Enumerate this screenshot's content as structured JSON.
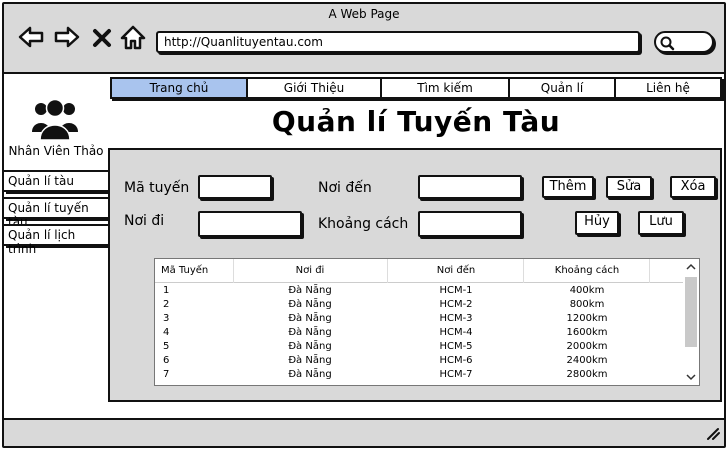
{
  "window": {
    "title": "A Web Page",
    "url": "http://Quanlituyentau.com"
  },
  "nav": {
    "tabs": [
      {
        "label": "Trang chủ",
        "active": true
      },
      {
        "label": "Giới Thiệu",
        "active": false
      },
      {
        "label": "Tìm kiếm",
        "active": false
      },
      {
        "label": "Quản lí",
        "active": false
      },
      {
        "label": "Liên hệ",
        "active": false
      }
    ]
  },
  "page": {
    "heading": "Quản lí Tuyến Tàu"
  },
  "sidebar": {
    "employee_name": "Nhân Viên Thảo",
    "items": [
      {
        "label": "Quản lí tàu"
      },
      {
        "label": "Quản lí tuyến tàu"
      },
      {
        "label": "Quản lí lịch trình"
      }
    ]
  },
  "form": {
    "route_code_label": "Mã tuyến",
    "destination_label": "Nơi đến",
    "origin_label": "Nơi đi",
    "distance_label": "Khoảng cách",
    "route_code_value": "",
    "destination_value": "",
    "origin_value": "",
    "distance_value": ""
  },
  "buttons": {
    "add": "Thêm",
    "edit": "Sửa",
    "delete": "Xóa",
    "cancel": "Hủy",
    "save": "Lưu"
  },
  "table": {
    "headers": [
      "Mã Tuyến",
      "Nơi đi",
      "Nơi đến",
      "Khoảng cách"
    ],
    "rows": [
      [
        "1",
        "Đà Nẵng",
        "HCM-1",
        "400km"
      ],
      [
        "2",
        "Đà Nẵng",
        "HCM-2",
        "800km"
      ],
      [
        "3",
        "Đà Nẵng",
        "HCM-3",
        "1200km"
      ],
      [
        "4",
        "Đà Nẵng",
        "HCM-4",
        "1600km"
      ],
      [
        "5",
        "Đà Nẵng",
        "HCM-5",
        "2000km"
      ],
      [
        "6",
        "Đà Nẵng",
        "HCM-6",
        "2400km"
      ],
      [
        "7",
        "Đà Nẵng",
        "HCM-7",
        "2800km"
      ]
    ]
  },
  "colors": {
    "active_tab": "#a9c4ee",
    "panel": "#d9d9d9",
    "border": "#111111"
  },
  "icons": [
    "back-icon",
    "forward-icon",
    "close-icon",
    "home-icon",
    "search-icon",
    "users-icon",
    "resize-grip-icon",
    "chevron-up-icon",
    "chevron-down-icon"
  ]
}
